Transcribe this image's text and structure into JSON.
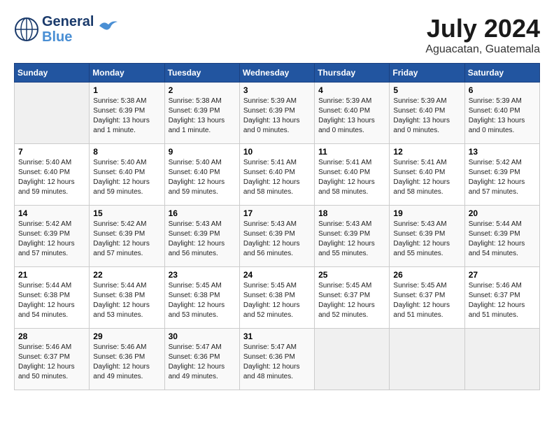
{
  "header": {
    "logo_line1": "General",
    "logo_line2": "Blue",
    "month_year": "July 2024",
    "location": "Aguacatan, Guatemala"
  },
  "days_of_week": [
    "Sunday",
    "Monday",
    "Tuesday",
    "Wednesday",
    "Thursday",
    "Friday",
    "Saturday"
  ],
  "weeks": [
    [
      {
        "date": "",
        "sunrise": "",
        "sunset": "",
        "daylight": "",
        "empty": true
      },
      {
        "date": "1",
        "sunrise": "Sunrise: 5:38 AM",
        "sunset": "Sunset: 6:39 PM",
        "daylight": "Daylight: 13 hours and 1 minute."
      },
      {
        "date": "2",
        "sunrise": "Sunrise: 5:38 AM",
        "sunset": "Sunset: 6:39 PM",
        "daylight": "Daylight: 13 hours and 1 minute."
      },
      {
        "date": "3",
        "sunrise": "Sunrise: 5:39 AM",
        "sunset": "Sunset: 6:39 PM",
        "daylight": "Daylight: 13 hours and 0 minutes."
      },
      {
        "date": "4",
        "sunrise": "Sunrise: 5:39 AM",
        "sunset": "Sunset: 6:40 PM",
        "daylight": "Daylight: 13 hours and 0 minutes."
      },
      {
        "date": "5",
        "sunrise": "Sunrise: 5:39 AM",
        "sunset": "Sunset: 6:40 PM",
        "daylight": "Daylight: 13 hours and 0 minutes."
      },
      {
        "date": "6",
        "sunrise": "Sunrise: 5:39 AM",
        "sunset": "Sunset: 6:40 PM",
        "daylight": "Daylight: 13 hours and 0 minutes."
      }
    ],
    [
      {
        "date": "7",
        "sunrise": "Sunrise: 5:40 AM",
        "sunset": "Sunset: 6:40 PM",
        "daylight": "Daylight: 12 hours and 59 minutes."
      },
      {
        "date": "8",
        "sunrise": "Sunrise: 5:40 AM",
        "sunset": "Sunset: 6:40 PM",
        "daylight": "Daylight: 12 hours and 59 minutes."
      },
      {
        "date": "9",
        "sunrise": "Sunrise: 5:40 AM",
        "sunset": "Sunset: 6:40 PM",
        "daylight": "Daylight: 12 hours and 59 minutes."
      },
      {
        "date": "10",
        "sunrise": "Sunrise: 5:41 AM",
        "sunset": "Sunset: 6:40 PM",
        "daylight": "Daylight: 12 hours and 58 minutes."
      },
      {
        "date": "11",
        "sunrise": "Sunrise: 5:41 AM",
        "sunset": "Sunset: 6:40 PM",
        "daylight": "Daylight: 12 hours and 58 minutes."
      },
      {
        "date": "12",
        "sunrise": "Sunrise: 5:41 AM",
        "sunset": "Sunset: 6:40 PM",
        "daylight": "Daylight: 12 hours and 58 minutes."
      },
      {
        "date": "13",
        "sunrise": "Sunrise: 5:42 AM",
        "sunset": "Sunset: 6:39 PM",
        "daylight": "Daylight: 12 hours and 57 minutes."
      }
    ],
    [
      {
        "date": "14",
        "sunrise": "Sunrise: 5:42 AM",
        "sunset": "Sunset: 6:39 PM",
        "daylight": "Daylight: 12 hours and 57 minutes."
      },
      {
        "date": "15",
        "sunrise": "Sunrise: 5:42 AM",
        "sunset": "Sunset: 6:39 PM",
        "daylight": "Daylight: 12 hours and 57 minutes."
      },
      {
        "date": "16",
        "sunrise": "Sunrise: 5:43 AM",
        "sunset": "Sunset: 6:39 PM",
        "daylight": "Daylight: 12 hours and 56 minutes."
      },
      {
        "date": "17",
        "sunrise": "Sunrise: 5:43 AM",
        "sunset": "Sunset: 6:39 PM",
        "daylight": "Daylight: 12 hours and 56 minutes."
      },
      {
        "date": "18",
        "sunrise": "Sunrise: 5:43 AM",
        "sunset": "Sunset: 6:39 PM",
        "daylight": "Daylight: 12 hours and 55 minutes."
      },
      {
        "date": "19",
        "sunrise": "Sunrise: 5:43 AM",
        "sunset": "Sunset: 6:39 PM",
        "daylight": "Daylight: 12 hours and 55 minutes."
      },
      {
        "date": "20",
        "sunrise": "Sunrise: 5:44 AM",
        "sunset": "Sunset: 6:39 PM",
        "daylight": "Daylight: 12 hours and 54 minutes."
      }
    ],
    [
      {
        "date": "21",
        "sunrise": "Sunrise: 5:44 AM",
        "sunset": "Sunset: 6:38 PM",
        "daylight": "Daylight: 12 hours and 54 minutes."
      },
      {
        "date": "22",
        "sunrise": "Sunrise: 5:44 AM",
        "sunset": "Sunset: 6:38 PM",
        "daylight": "Daylight: 12 hours and 53 minutes."
      },
      {
        "date": "23",
        "sunrise": "Sunrise: 5:45 AM",
        "sunset": "Sunset: 6:38 PM",
        "daylight": "Daylight: 12 hours and 53 minutes."
      },
      {
        "date": "24",
        "sunrise": "Sunrise: 5:45 AM",
        "sunset": "Sunset: 6:38 PM",
        "daylight": "Daylight: 12 hours and 52 minutes."
      },
      {
        "date": "25",
        "sunrise": "Sunrise: 5:45 AM",
        "sunset": "Sunset: 6:37 PM",
        "daylight": "Daylight: 12 hours and 52 minutes."
      },
      {
        "date": "26",
        "sunrise": "Sunrise: 5:45 AM",
        "sunset": "Sunset: 6:37 PM",
        "daylight": "Daylight: 12 hours and 51 minutes."
      },
      {
        "date": "27",
        "sunrise": "Sunrise: 5:46 AM",
        "sunset": "Sunset: 6:37 PM",
        "daylight": "Daylight: 12 hours and 51 minutes."
      }
    ],
    [
      {
        "date": "28",
        "sunrise": "Sunrise: 5:46 AM",
        "sunset": "Sunset: 6:37 PM",
        "daylight": "Daylight: 12 hours and 50 minutes."
      },
      {
        "date": "29",
        "sunrise": "Sunrise: 5:46 AM",
        "sunset": "Sunset: 6:36 PM",
        "daylight": "Daylight: 12 hours and 49 minutes."
      },
      {
        "date": "30",
        "sunrise": "Sunrise: 5:47 AM",
        "sunset": "Sunset: 6:36 PM",
        "daylight": "Daylight: 12 hours and 49 minutes."
      },
      {
        "date": "31",
        "sunrise": "Sunrise: 5:47 AM",
        "sunset": "Sunset: 6:36 PM",
        "daylight": "Daylight: 12 hours and 48 minutes."
      },
      {
        "date": "",
        "sunrise": "",
        "sunset": "",
        "daylight": "",
        "empty": true
      },
      {
        "date": "",
        "sunrise": "",
        "sunset": "",
        "daylight": "",
        "empty": true
      },
      {
        "date": "",
        "sunrise": "",
        "sunset": "",
        "daylight": "",
        "empty": true
      }
    ]
  ]
}
